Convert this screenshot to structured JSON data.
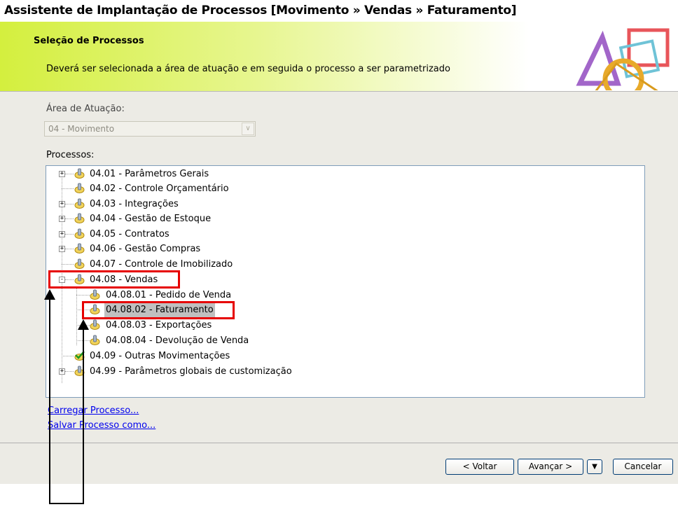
{
  "window": {
    "title": "Assistente de Implantação de Processos [Movimento » Vendas » Faturamento]"
  },
  "header": {
    "title": "Seleção de Processos",
    "description": "Deverá ser selecionada a área de atuação e em seguida o processo a ser parametrizado",
    "logo_icon": "abstract-shapes-logo"
  },
  "area": {
    "label": "Área de Atuação:",
    "value": "04 - Movimento"
  },
  "processes": {
    "label": "Processos:",
    "items": [
      {
        "label": "04.01 - Parâmetros Gerais",
        "expander": "+",
        "icon": "folder-hand-icon"
      },
      {
        "label": "04.02 - Controle Orçamentário",
        "expander": "",
        "icon": "folder-hand-icon"
      },
      {
        "label": "04.03 - Integrações",
        "expander": "+",
        "icon": "folder-hand-icon"
      },
      {
        "label": "04.04 - Gestão de Estoque",
        "expander": "+",
        "icon": "folder-hand-icon"
      },
      {
        "label": "04.05 - Contratos",
        "expander": "+",
        "icon": "folder-hand-icon"
      },
      {
        "label": "04.06 - Gestão Compras",
        "expander": "+",
        "icon": "folder-hand-icon"
      },
      {
        "label": "04.07 - Controle de Imobilizado",
        "expander": "",
        "icon": "folder-hand-icon"
      },
      {
        "label": "04.08 - Vendas",
        "expander": "-",
        "icon": "folder-hand-icon"
      },
      {
        "label": "04.08.01 - Pedido de Venda",
        "expander": "",
        "icon": "folder-hand-icon"
      },
      {
        "label": "04.08.02 - Faturamento",
        "expander": "",
        "icon": "folder-hand-icon",
        "selected": true
      },
      {
        "label": "04.08.03 - Exportações",
        "expander": "",
        "icon": "folder-hand-icon"
      },
      {
        "label": "04.08.04 - Devolução de Venda",
        "expander": "",
        "icon": "folder-hand-icon"
      },
      {
        "label": "04.09 - Outras Movimentações",
        "expander": "",
        "icon": "check-icon"
      },
      {
        "label": "04.99 - Parâmetros globais de customização",
        "expander": "+",
        "icon": "folder-hand-icon"
      }
    ]
  },
  "links": {
    "load": "Carregar Processo...",
    "save": "Salvar Processo como..."
  },
  "buttons": {
    "back": "< Voltar",
    "next": "Avançar >",
    "cancel": "Cancelar"
  },
  "colors": {
    "header_green": "#d4ef3e",
    "annotation_red": "#e60000",
    "link_blue": "#0000ee",
    "selection_gray": "#c0c0c0"
  }
}
